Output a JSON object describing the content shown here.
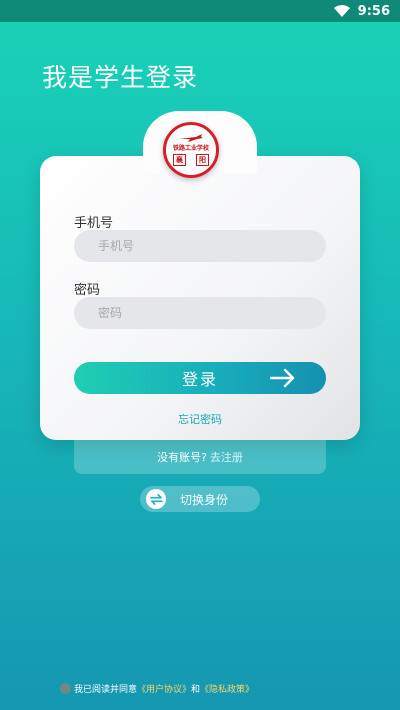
{
  "status_bar": {
    "time": "9:56"
  },
  "page": {
    "title": "我是学生登录"
  },
  "logo": {
    "school_name": "铁路工业学校",
    "left_char": "襄",
    "right_char": "阳"
  },
  "form": {
    "phone_label": "手机号",
    "phone_placeholder": "手机号",
    "password_label": "密码",
    "password_placeholder": "密码",
    "login_label": "登录",
    "forgot_label": "忘记密码"
  },
  "register": {
    "prompt": "没有账号?",
    "link": "去注册"
  },
  "switch_identity": {
    "label": "切换身份"
  },
  "agreement": {
    "prefix": "我已阅读并同意",
    "user_agreement": "《用户协议》",
    "and": "和",
    "privacy_policy": "《隐私政策》"
  },
  "colors": {
    "accent_start": "#1fcfb1",
    "accent_end": "#1591b0",
    "status_bar": "#0f8a78",
    "logo_red": "#d42027",
    "link_teal": "#1aa7b4",
    "agreement_link": "#f2d66b"
  },
  "icons": {
    "wifi": "wifi-icon",
    "arrow": "arrow-right-icon",
    "switch": "swap-icon",
    "check": "radio-check-icon"
  }
}
